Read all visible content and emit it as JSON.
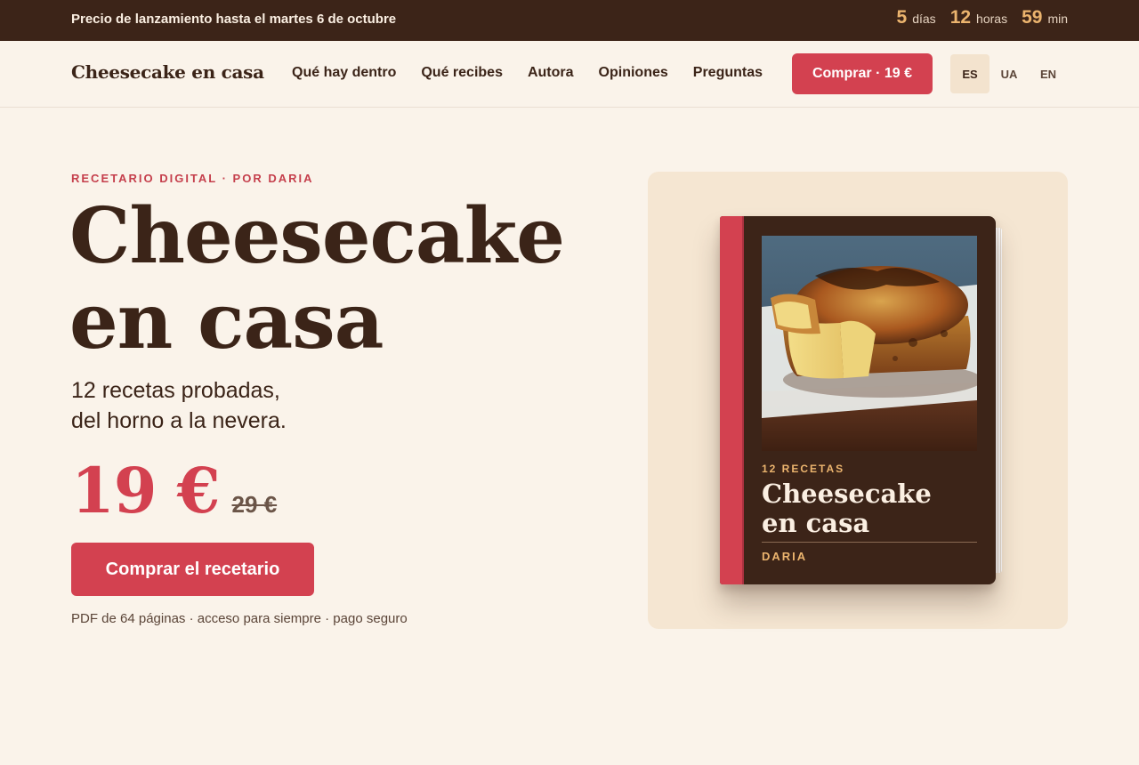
{
  "topbar": {
    "promo_text": "Precio de lanzamiento hasta el martes 6 de octubre",
    "countdown": [
      {
        "value": "5",
        "unit": "días"
      },
      {
        "value": "12",
        "unit": "horas"
      },
      {
        "value": "59",
        "unit": "min"
      }
    ]
  },
  "nav": {
    "brand": "Cheesecake en casa",
    "menu": [
      "Qué hay dentro",
      "Qué recibes",
      "Autora",
      "Opiniones",
      "Preguntas"
    ],
    "buy_label": "Comprar · 19 €",
    "languages": [
      "ES",
      "UA",
      "EN"
    ],
    "active_language": "ES"
  },
  "hero": {
    "eyebrow": "RECETARIO DIGITAL · POR DARIA",
    "title_line1": "Cheesecake",
    "title_line2": "en casa",
    "subtitle_line1": "12 recetas probadas,",
    "subtitle_line2": "del horno a la nevera.",
    "price_now": "19 €",
    "price_old": "29 €",
    "buy_label": "Comprar el recetario",
    "note": "PDF de 64 páginas · acceso para siempre · pago seguro"
  },
  "cover": {
    "kicker": "12 RECETAS",
    "title_line1": "Cheesecake",
    "title_line2": "en casa",
    "author": "DARIA"
  },
  "colors": {
    "accent": "#d34150",
    "dark_brown": "#3c2418",
    "gold": "#ebb46e",
    "cream": "#faf3ea"
  }
}
